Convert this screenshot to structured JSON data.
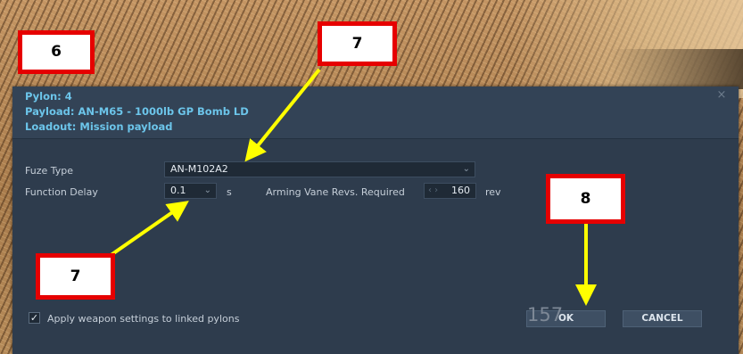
{
  "dialog": {
    "pylon_line": "Pylon: 4",
    "payload_line": "Payload: AN-M65 - 1000lb GP Bomb LD",
    "loadout_line": "Loadout: Mission payload",
    "close_glyph": "×"
  },
  "fields": {
    "fuze_type_label": "Fuze Type",
    "fuze_type_value": "AN-M102A2",
    "function_delay_label": "Function Delay",
    "function_delay_value": "0.1",
    "function_delay_unit": "s",
    "arming_vane_label": "Arming Vane Revs. Required",
    "arming_vane_value": "160",
    "arming_vane_unit": "rev"
  },
  "apply_checkbox": {
    "label": "Apply weapon settings to linked pylons",
    "checked": true
  },
  "buttons": {
    "ok_label": "OK",
    "cancel_label": "CANCEL"
  },
  "overlay_counter": "157",
  "annotations": {
    "callout_6": "6",
    "callout_7_top": "7",
    "callout_7_bottom": "7",
    "callout_8": "8",
    "callout_border_color": "#e60000",
    "arrow_color": "#ffff00"
  },
  "colors": {
    "header_text": "#6cc5ea",
    "dialog_bg": "#2e3c4d"
  }
}
